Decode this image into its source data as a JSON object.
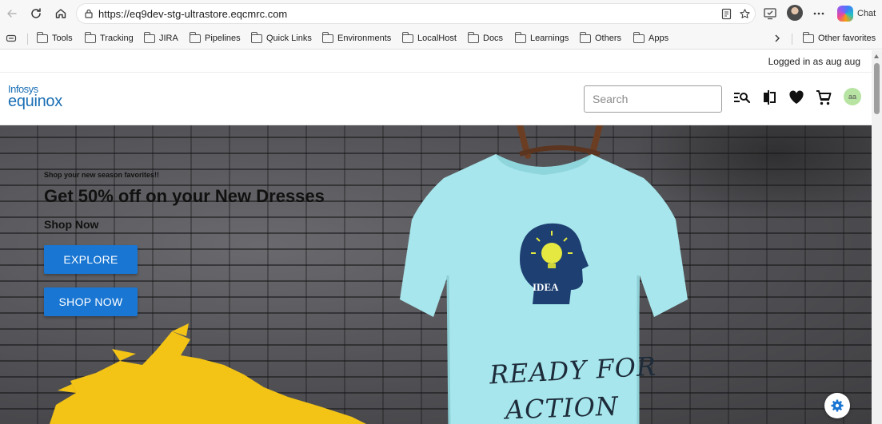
{
  "browser": {
    "url": "https://eq9dev-stg-ultrastore.eqcmrc.com",
    "chat_label": "Chat",
    "icons": [
      "back-icon",
      "refresh-icon",
      "home-icon",
      "lock-icon",
      "reader-mode-icon",
      "favorite-star-icon",
      "screen-cast-icon",
      "more-icon",
      "copilot-icon"
    ]
  },
  "bookmarks": {
    "items": [
      {
        "label": "Tools"
      },
      {
        "label": "Tracking"
      },
      {
        "label": "JIRA"
      },
      {
        "label": "Pipelines"
      },
      {
        "label": "Quick Links"
      },
      {
        "label": "Environments"
      },
      {
        "label": "LocalHost"
      },
      {
        "label": "Docs"
      },
      {
        "label": "Learnings"
      },
      {
        "label": "Others"
      },
      {
        "label": "Apps"
      }
    ],
    "other_favorites": "Other favorites"
  },
  "site": {
    "login_status": "Logged in as aug aug",
    "logo_brand": "Infosys",
    "logo_product": "equinox",
    "search_placeholder": "Search",
    "avatar_initials": "aa",
    "header_icons": [
      "search-list-icon",
      "compare-icon",
      "wishlist-heart-icon",
      "cart-icon"
    ]
  },
  "hero": {
    "tagline": "Shop your new season favorites!!",
    "headline": "Get 50% off on your New Dresses",
    "subhead": "Shop Now",
    "explore_button": "EXPLORE",
    "shop_button": "SHOP NOW",
    "tshirt_badge": "IDEA",
    "tshirt_line1": "READY FOR",
    "tshirt_line2": "ACTION",
    "colors": {
      "shirt": "#a7e6ec",
      "button": "#1976d2",
      "paint": "#f3c316",
      "logo": "#1a6fb4"
    }
  }
}
